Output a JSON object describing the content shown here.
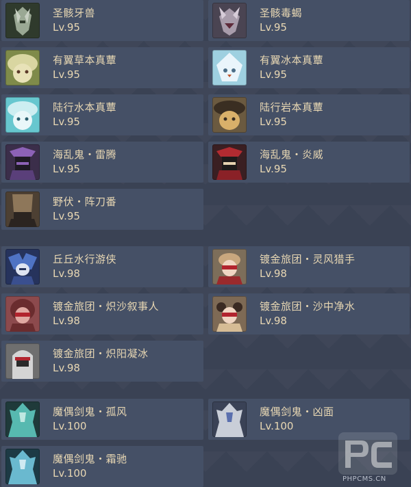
{
  "enemies": [
    {
      "name": "圣骸牙兽",
      "level": "Lv.95",
      "portrait": "primal-construct-beast",
      "bg": "#2f3a2c",
      "fg": "#9aa894",
      "accent": "#c7cfc2"
    },
    {
      "name": "圣骸毒蝎",
      "level": "Lv.95",
      "portrait": "primal-construct-scorpion",
      "bg": "#4a4452",
      "fg": "#a89cab",
      "accent": "#d6ccd8"
    },
    {
      "name": "有翼草本真蕈",
      "level": "Lv.95",
      "portrait": "winged-dendroshroom",
      "bg": "#7f8b4a",
      "fg": "#d9d6a1",
      "accent": "#5c3a2a"
    },
    {
      "name": "有翼冰本真蕈",
      "level": "Lv.95",
      "portrait": "winged-cryoshroom",
      "bg": "#9ed0e0",
      "fg": "#eaf5fb",
      "accent": "#4c6e87"
    },
    {
      "name": "陆行水本真蕈",
      "level": "Lv.95",
      "portrait": "walking-hydroshroom",
      "bg": "#67c7cf",
      "fg": "#cdeef1",
      "accent": "#2c5f6e"
    },
    {
      "name": "陆行岩本真蕈",
      "level": "Lv.95",
      "portrait": "walking-geoshroom",
      "bg": "#6b5a40",
      "fg": "#d9b06a",
      "accent": "#3a2e22"
    },
    {
      "name": "海乱鬼・雷腾",
      "level": "Lv.95",
      "portrait": "electro-nobushi",
      "bg": "#3b2e4a",
      "fg": "#8c62b6",
      "accent": "#1e1a24"
    },
    {
      "name": "海乱鬼・炎威",
      "level": "Lv.95",
      "portrait": "pyro-nobushi",
      "bg": "#3a1f22",
      "fg": "#b22b31",
      "accent": "#1e1a1a"
    },
    {
      "name": "野伏・阵刀番",
      "level": "Lv.95",
      "portrait": "kairagi-jintouban",
      "bg": "#4d4033",
      "fg": "#8e775a",
      "accent": "#2b2420"
    },
    {
      "name": "丘丘水行游侠",
      "level": "Lv.98",
      "portrait": "hilichurl-hydro-ranger",
      "bg": "#26335c",
      "fg": "#4f73c4",
      "accent": "#dfe4f1"
    },
    {
      "name": "镀金旅团・灵风猎手",
      "level": "Lv.98",
      "portrait": "eremite-wind-hunter",
      "bg": "#7d6e5a",
      "fg": "#c9a77e",
      "accent": "#b2242e"
    },
    {
      "name": "镀金旅团・炽沙叙事人",
      "level": "Lv.98",
      "portrait": "eremite-sand-narrator",
      "bg": "#8c4a4d",
      "fg": "#e0a9a2",
      "accent": "#b2242e"
    },
    {
      "name": "镀金旅团・沙中净水",
      "level": "Lv.98",
      "portrait": "eremite-purifier",
      "bg": "#7e6a55",
      "fg": "#d6bc95",
      "accent": "#b2242e"
    },
    {
      "name": "镀金旅团・炽阳凝冰",
      "level": "Lv.98",
      "portrait": "eremite-frost",
      "bg": "#6f6f6f",
      "fg": "#d4d4d4",
      "accent": "#b2242e"
    },
    {
      "name": "魔偶剑鬼・孤风",
      "level": "Lv.100",
      "portrait": "maguu-kenki-lone-gale",
      "bg": "#1f3a3a",
      "fg": "#57b9b0",
      "accent": "#bfe8e2"
    },
    {
      "name": "魔偶剑鬼・凶面",
      "level": "Lv.100",
      "portrait": "maguu-kenki-evil-mask",
      "bg": "#3a4256",
      "fg": "#c9ced8",
      "accent": "#5a6fae"
    },
    {
      "name": "魔偶剑鬼・霜驰",
      "level": "Lv.100",
      "portrait": "maguu-kenki-frost-runner",
      "bg": "#1d3a45",
      "fg": "#6ab9cf",
      "accent": "#cfeaf2"
    }
  ],
  "watermark": {
    "logo": "PC",
    "text": "PHPCMS.CN"
  }
}
